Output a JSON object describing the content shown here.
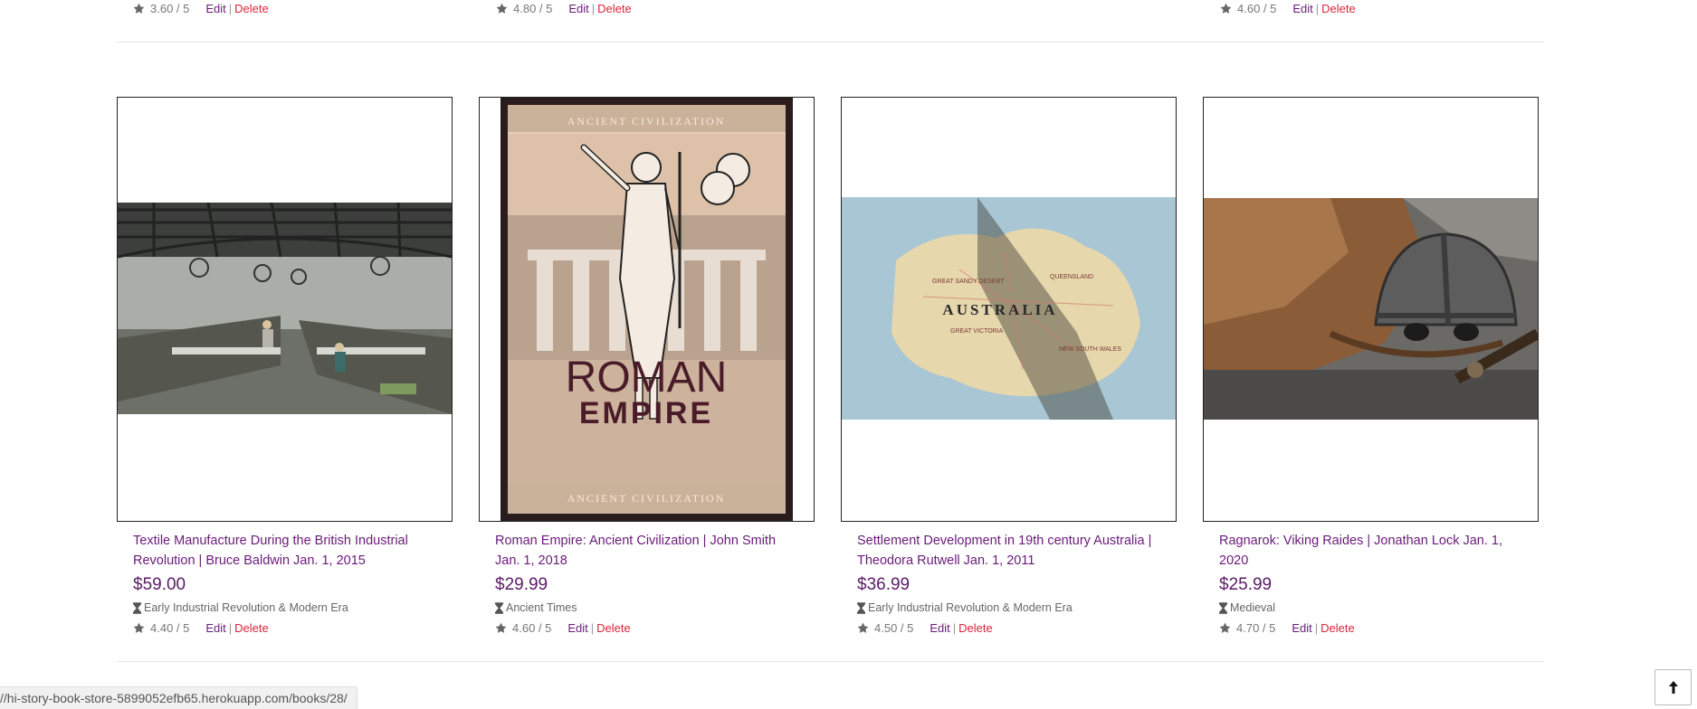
{
  "top_row": [
    {
      "rating": "3.60 / 5",
      "edit": "Edit",
      "sep": "|",
      "delete": "Delete"
    },
    {
      "rating": "4.80 / 5",
      "edit": "Edit",
      "sep": "|",
      "delete": "Delete"
    },
    {
      "rating": "4.60 / 5",
      "edit": "Edit",
      "sep": "|",
      "delete": "Delete"
    }
  ],
  "books": [
    {
      "title": "Textile Manufacture During the British Industrial Revolution | Bruce Baldwin Jan. 1, 2015",
      "price": "$59.00",
      "category": "Early Industrial Revolution & Modern Era",
      "rating": "4.40 / 5",
      "edit": "Edit",
      "sep": "|",
      "delete": "Delete"
    },
    {
      "title": "Roman Empire: Ancient Civilization | John Smith Jan. 1, 2018",
      "price": "$29.99",
      "category": "Ancient Times",
      "rating": "4.60 / 5",
      "edit": "Edit",
      "sep": "|",
      "delete": "Delete",
      "cover": {
        "top": "ANCIENT CIVILIZATION",
        "line1": "ROMAN",
        "line2": "EMPIRE",
        "bottom": "ANCIENT CIVILIZATION"
      }
    },
    {
      "title": "Settlement Development in 19th century Australia | Theodora Rutwell Jan. 1, 2011",
      "price": "$36.99",
      "category": "Early Industrial Revolution & Modern Era",
      "rating": "4.50 / 5",
      "edit": "Edit",
      "sep": "|",
      "delete": "Delete",
      "map_label": "AUSTRALIA"
    },
    {
      "title": "Ragnarok: Viking Raides | Jonathan Lock Jan. 1, 2020",
      "price": "$25.99",
      "category": "Medieval",
      "rating": "4.70 / 5",
      "edit": "Edit",
      "sep": "|",
      "delete": "Delete"
    }
  ],
  "status_bar": {
    "url": "//hi-story-book-store-5899052efb65.herokuapp.com/books/28/"
  },
  "icons": {
    "star": "star-icon",
    "category": "hourglass-icon",
    "scroll_top": "arrow-up-icon"
  },
  "colors": {
    "link": "#6a1b7a",
    "price": "#5a1c66",
    "delete": "#d9263a"
  }
}
